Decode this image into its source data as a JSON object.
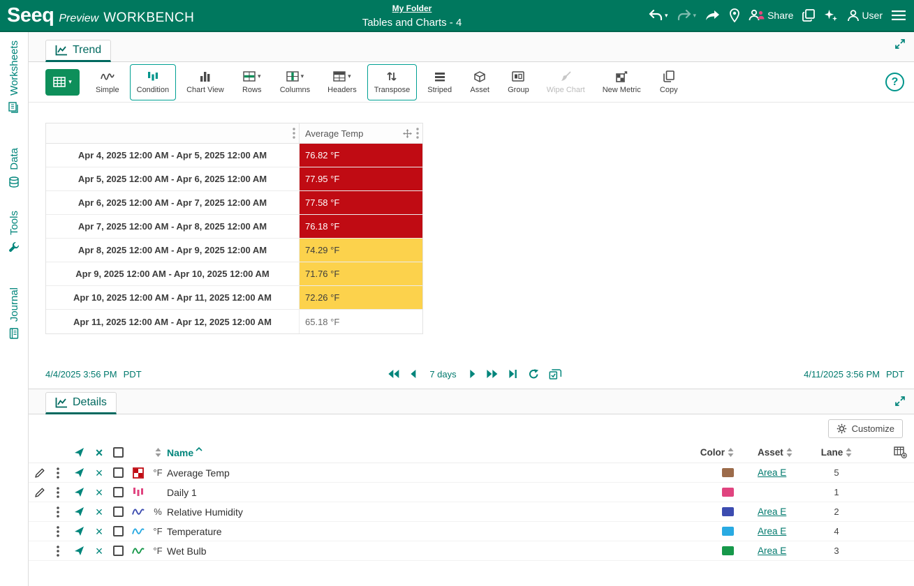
{
  "colors": {
    "topbar_green": "#00785e",
    "accent_teal": "#00857b",
    "button_green": "#0e8f5a",
    "alert_red": "#c00b13",
    "warn_yellow": "#fcd24c"
  },
  "icons": {
    "caret_down": "▾",
    "close": "×",
    "help": "?"
  },
  "topbar": {
    "logo": "Seeq",
    "preview_label": "Preview",
    "workbench_label": "WORKBENCH",
    "breadcrumb": "My Folder",
    "title": "Tables and Charts - 4",
    "share_label": "Share",
    "user_label": "User"
  },
  "sidebar": {
    "items": [
      {
        "label": "Worksheets"
      },
      {
        "label": "Data"
      },
      {
        "label": "Tools"
      },
      {
        "label": "Journal"
      }
    ]
  },
  "trend_panel": {
    "tab_label": "Trend",
    "toolbar": {
      "simple": "Simple",
      "condition": "Condition",
      "chart_view": "Chart View",
      "rows": "Rows",
      "columns": "Columns",
      "headers": "Headers",
      "transpose": "Transpose",
      "striped": "Striped",
      "asset": "Asset",
      "group": "Group",
      "wipe_chart": "Wipe Chart",
      "new_metric": "New Metric",
      "copy": "Copy"
    },
    "table": {
      "value_header": "Average Temp",
      "rows": [
        {
          "label": "Apr 4, 2025 12:00 AM - Apr 5, 2025 12:00 AM",
          "value": "76.82 °F",
          "bg": "#c00b13",
          "fg": "#ffffff"
        },
        {
          "label": "Apr 5, 2025 12:00 AM - Apr 6, 2025 12:00 AM",
          "value": "77.95 °F",
          "bg": "#c00b13",
          "fg": "#ffffff"
        },
        {
          "label": "Apr 6, 2025 12:00 AM - Apr 7, 2025 12:00 AM",
          "value": "77.58 °F",
          "bg": "#c00b13",
          "fg": "#ffffff"
        },
        {
          "label": "Apr 7, 2025 12:00 AM - Apr 8, 2025 12:00 AM",
          "value": "76.18 °F",
          "bg": "#c00b13",
          "fg": "#ffffff"
        },
        {
          "label": "Apr 8, 2025 12:00 AM - Apr 9, 2025 12:00 AM",
          "value": "74.29 °F",
          "bg": "#fcd24c",
          "fg": "#3c3c3c"
        },
        {
          "label": "Apr 9, 2025 12:00 AM - Apr 10, 2025 12:00 AM",
          "value": "71.76 °F",
          "bg": "#fcd24c",
          "fg": "#3c3c3c"
        },
        {
          "label": "Apr 10, 2025 12:00 AM - Apr 11, 2025 12:00 AM",
          "value": "72.26 °F",
          "bg": "#fcd24c",
          "fg": "#3c3c3c"
        },
        {
          "label": "Apr 11, 2025 12:00 AM - Apr 12, 2025 12:00 AM",
          "value": "65.18 °F",
          "bg": "#ffffff",
          "fg": "#6a6a6a"
        }
      ]
    },
    "timebar": {
      "start_date": "4/4/2025 3:56 PM",
      "start_tz": "PDT",
      "duration": "7 days",
      "end_date": "4/11/2025 3:56 PM",
      "end_tz": "PDT"
    }
  },
  "details_panel": {
    "tab_label": "Details",
    "customize_label": "Customize",
    "columns": {
      "name": "Name",
      "color": "Color",
      "asset": "Asset",
      "lane": "Lane"
    },
    "rows": [
      {
        "type": "metric",
        "unit": "°F",
        "name": "Average Temp",
        "color": "#9c6b4a",
        "asset": "Area E",
        "lane": "5"
      },
      {
        "type": "condition",
        "unit": "",
        "name": "Daily 1",
        "color": "#e0447f",
        "asset": "",
        "lane": "1"
      },
      {
        "type": "signal",
        "unit": "%",
        "name": "Relative Humidity",
        "color": "#3c4cb0",
        "asset": "Area E",
        "lane": "2"
      },
      {
        "type": "signal",
        "unit": "°F",
        "name": "Temperature",
        "color": "#29aae2",
        "asset": "Area E",
        "lane": "4"
      },
      {
        "type": "signal",
        "unit": "°F",
        "name": "Wet Bulb",
        "color": "#16984a",
        "asset": "Area E",
        "lane": "3"
      }
    ]
  }
}
